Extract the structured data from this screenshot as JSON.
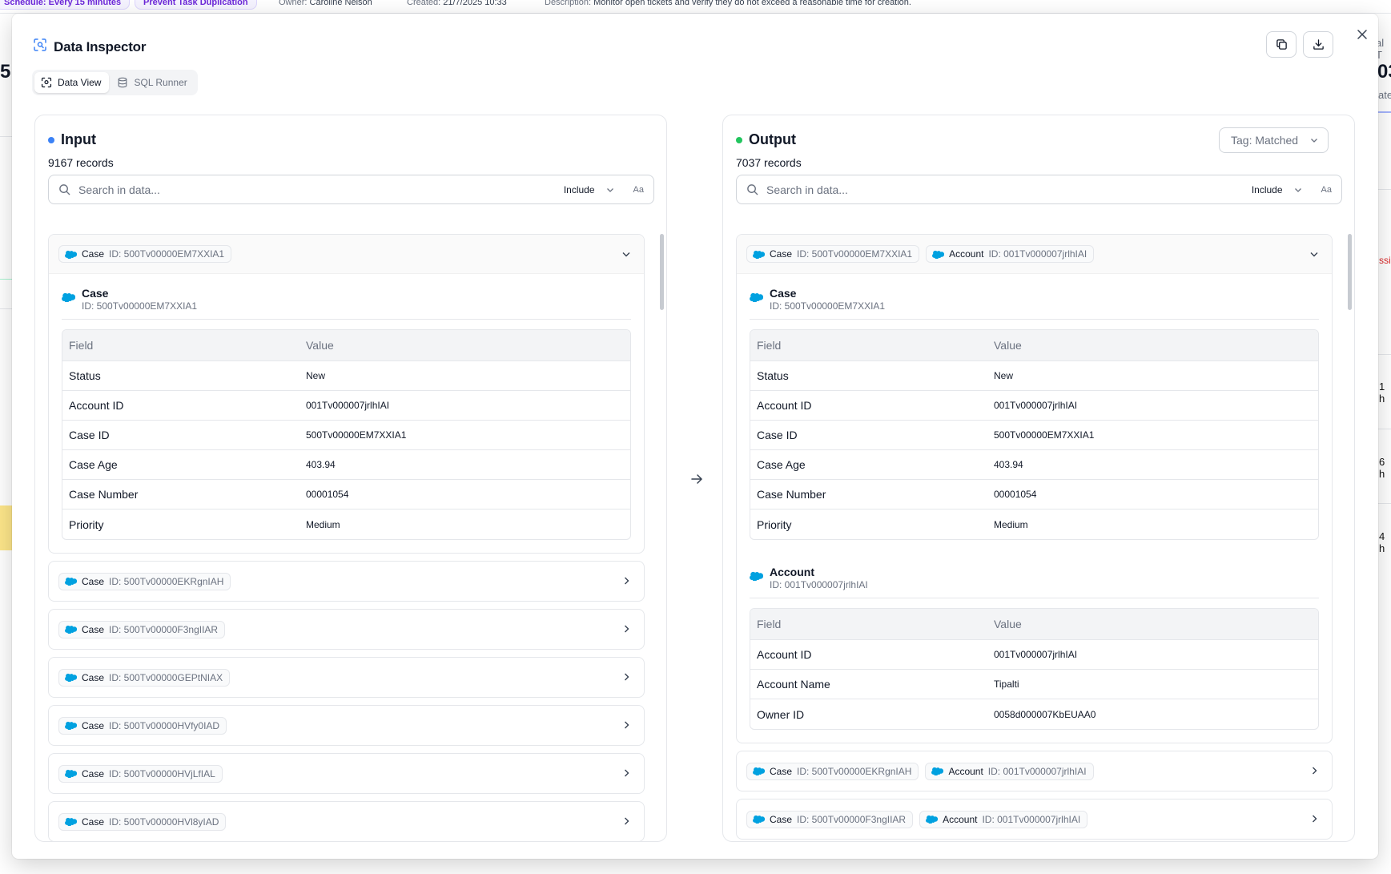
{
  "background": {
    "chip_schedule": "Schedule: Every 15 minutes",
    "chip_prevent": "Prevent Task Duplication",
    "owner_label": "Owner:",
    "owner_value": "Caroline Nelson",
    "created_label": "Created:",
    "created_value": "21/7/2025 10:33",
    "description_label": "Description:",
    "description_value": "Monitor open tickets and verify they do not exceed a reasonable time for creation.",
    "left_number": "5",
    "right_number": "03",
    "right_top": "al T",
    "right_sub": "ate",
    "right_red": "ssi",
    "right_h1": "1 h",
    "right_h2": "6 h",
    "right_h3": "4 h"
  },
  "modal": {
    "title": "Data Inspector",
    "tabs": [
      {
        "label": "Data View",
        "icon": "scan-icon",
        "active": true
      },
      {
        "label": "SQL Runner",
        "icon": "database-icon",
        "active": false
      }
    ]
  },
  "colors": {
    "input_dot": "#3b82f6",
    "output_dot": "#22c55e",
    "salesforce": "#00a1e0"
  },
  "input": {
    "title": "Input",
    "count": "9167 records",
    "search_placeholder": "Search in data...",
    "include_label": "Include",
    "case_toggle": "Aa",
    "expanded": {
      "chip_key": "Case",
      "chip_val": "ID: 500Tv00000EM7XXIA1",
      "object_name": "Case",
      "object_id": "ID: 500Tv00000EM7XXIA1",
      "header_field": "Field",
      "header_value": "Value",
      "rows": [
        {
          "field": "Status",
          "value": "New"
        },
        {
          "field": "Account ID",
          "value": "001Tv000007jrlhIAI"
        },
        {
          "field": "Case ID",
          "value": "500Tv00000EM7XXIA1"
        },
        {
          "field": "Case Age",
          "value": "403.94"
        },
        {
          "field": "Case Number",
          "value": "00001054"
        },
        {
          "field": "Priority",
          "value": "Medium"
        }
      ]
    },
    "collapsed": [
      {
        "key": "Case",
        "val": "ID: 500Tv00000EKRgnIAH"
      },
      {
        "key": "Case",
        "val": "ID: 500Tv00000F3ngIIAR"
      },
      {
        "key": "Case",
        "val": "ID: 500Tv00000GEPtNIAX"
      },
      {
        "key": "Case",
        "val": "ID: 500Tv00000HVfy0IAD"
      },
      {
        "key": "Case",
        "val": "ID: 500Tv00000HVjLfIAL"
      },
      {
        "key": "Case",
        "val": "ID: 500Tv00000HVl8yIAD"
      }
    ]
  },
  "output": {
    "title": "Output",
    "count": "7037 records",
    "tag_label": "Tag: Matched",
    "search_placeholder": "Search in data...",
    "include_label": "Include",
    "case_toggle": "Aa",
    "expanded": {
      "chip1_key": "Case",
      "chip1_val": "ID: 500Tv00000EM7XXIA1",
      "chip2_key": "Account",
      "chip2_val": "ID: 001Tv000007jrlhIAI",
      "case_name": "Case",
      "case_id": "ID: 500Tv00000EM7XXIA1",
      "account_name": "Account",
      "account_id": "ID: 001Tv000007jrlhIAI",
      "header_field": "Field",
      "header_value": "Value",
      "case_rows": [
        {
          "field": "Status",
          "value": "New"
        },
        {
          "field": "Account ID",
          "value": "001Tv000007jrlhIAI"
        },
        {
          "field": "Case ID",
          "value": "500Tv00000EM7XXIA1"
        },
        {
          "field": "Case Age",
          "value": "403.94"
        },
        {
          "field": "Case Number",
          "value": "00001054"
        },
        {
          "field": "Priority",
          "value": "Medium"
        }
      ],
      "account_rows": [
        {
          "field": "Account ID",
          "value": "001Tv000007jrlhIAI"
        },
        {
          "field": "Account Name",
          "value": "Tipalti"
        },
        {
          "field": "Owner ID",
          "value": "0058d000007KbEUAA0"
        }
      ]
    },
    "collapsed": [
      {
        "k1": "Case",
        "v1": "ID: 500Tv00000EKRgnIAH",
        "k2": "Account",
        "v2": "ID: 001Tv000007jrlhIAI"
      },
      {
        "k1": "Case",
        "v1": "ID: 500Tv00000F3ngIIAR",
        "k2": "Account",
        "v2": "ID: 001Tv000007jrlhIAI"
      }
    ]
  }
}
